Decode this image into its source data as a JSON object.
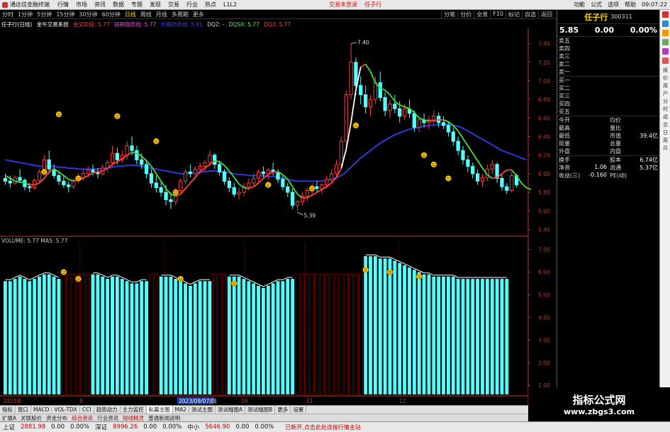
{
  "menubar": {
    "app_title": "通达信金融终端",
    "items": [
      "行情",
      "市场",
      "资讯",
      "数据",
      "专题",
      "发现",
      "交易",
      "行业",
      "热点",
      "L1L2"
    ],
    "active_index": -1,
    "promo": [
      "交易未登录",
      "任子行"
    ],
    "right": [
      "功能",
      "公式",
      "选项",
      "帮助",
      "09:07:22"
    ]
  },
  "toolbar": {
    "periods": [
      "分时",
      "1分钟",
      "5分钟",
      "15分钟",
      "30分钟",
      "60分钟",
      "日线",
      "周线",
      "月线",
      "多周期",
      "更多"
    ],
    "right": [
      "分笔",
      "分价",
      "全景",
      "F10",
      "标记",
      "自选",
      "返回"
    ]
  },
  "legend": {
    "title": "任子行(日线)",
    "system": "金牛交易系统",
    "items": [
      {
        "label": "金叉阶段: 5.77",
        "color": "#ff3b3b"
      },
      {
        "label": "短期趋势线: 5.77",
        "color": "#ff40ff"
      },
      {
        "label": "长期趋势线: 5.91",
        "color": "#3a3aff"
      },
      {
        "label": "DQ2: -",
        "color": "#dddddd"
      },
      {
        "label": "DQSX: 5.77",
        "color": "#44ff44"
      },
      {
        "label": "DQ3: 5.77",
        "color": "#ff4040"
      }
    ]
  },
  "volume_legend": {
    "label": "VOLUME: 5.77  MA5: 5.77"
  },
  "chart_data": {
    "type": "candlestick",
    "price_axis": [
      7.4,
      7.2,
      7.0,
      6.8,
      6.6,
      6.4,
      6.2,
      6.0,
      5.8,
      5.6,
      5.4
    ],
    "volume_axis": [
      7.0,
      6.0,
      5.0,
      4.0,
      3.0,
      2.0,
      1.0
    ],
    "date_labels": [
      "2023年",
      "8",
      "2023/09/07/四",
      "10",
      "11",
      "12"
    ],
    "annotations": {
      "high": "7.40",
      "low": "5.39"
    },
    "candles": [
      [
        5.95,
        6.0,
        5.88,
        5.92
      ],
      [
        5.92,
        5.98,
        5.85,
        5.9
      ],
      [
        5.9,
        5.98,
        5.88,
        5.96
      ],
      [
        5.96,
        6.05,
        5.9,
        5.93
      ],
      [
        5.93,
        5.95,
        5.82,
        5.86
      ],
      [
        5.86,
        5.9,
        5.8,
        5.85
      ],
      [
        5.85,
        5.95,
        5.83,
        5.93
      ],
      [
        5.93,
        6.05,
        5.9,
        6.02
      ],
      [
        6.02,
        6.2,
        5.98,
        6.15
      ],
      [
        6.15,
        6.25,
        6.0,
        6.05
      ],
      [
        6.05,
        6.1,
        5.95,
        5.98
      ],
      [
        5.98,
        6.02,
        5.88,
        5.92
      ],
      [
        5.92,
        5.98,
        5.85,
        5.88
      ],
      [
        5.88,
        5.92,
        5.8,
        5.86
      ],
      [
        5.86,
        5.95,
        5.84,
        5.93
      ],
      [
        5.93,
        6.0,
        5.9,
        5.96
      ],
      [
        5.96,
        6.05,
        5.93,
        6.0
      ],
      [
        6.0,
        6.08,
        5.96,
        6.04
      ],
      [
        6.04,
        6.1,
        5.98,
        6.02
      ],
      [
        6.02,
        6.06,
        5.95,
        6.0
      ],
      [
        6.0,
        6.1,
        5.98,
        6.06
      ],
      [
        6.06,
        6.15,
        6.02,
        6.12
      ],
      [
        6.12,
        6.3,
        6.08,
        6.22
      ],
      [
        6.22,
        6.28,
        6.1,
        6.15
      ],
      [
        6.15,
        6.25,
        6.12,
        6.2
      ],
      [
        6.2,
        6.35,
        6.15,
        6.3
      ],
      [
        6.3,
        6.4,
        6.2,
        6.25
      ],
      [
        6.25,
        6.3,
        6.1,
        6.15
      ],
      [
        6.15,
        6.22,
        6.05,
        6.1
      ],
      [
        6.1,
        6.15,
        5.95,
        6.0
      ],
      [
        6.0,
        6.05,
        5.85,
        5.9
      ],
      [
        5.9,
        5.98,
        5.8,
        5.85
      ],
      [
        5.85,
        5.92,
        5.75,
        5.8
      ],
      [
        5.8,
        5.88,
        5.66,
        5.72
      ],
      [
        5.72,
        5.8,
        5.62,
        5.7
      ],
      [
        5.7,
        5.85,
        5.66,
        5.82
      ],
      [
        5.82,
        5.95,
        5.78,
        5.92
      ],
      [
        5.92,
        6.05,
        5.88,
        6.02
      ],
      [
        6.02,
        6.1,
        5.96,
        6.0
      ],
      [
        6.0,
        6.08,
        5.94,
        6.05
      ],
      [
        6.05,
        6.12,
        6.0,
        6.08
      ],
      [
        6.08,
        6.15,
        6.02,
        6.12
      ],
      [
        6.12,
        6.25,
        6.08,
        6.2
      ],
      [
        6.2,
        6.22,
        6.05,
        6.1
      ],
      [
        6.1,
        6.14,
        5.98,
        6.02
      ],
      [
        6.02,
        6.05,
        5.88,
        5.92
      ],
      [
        5.92,
        5.96,
        5.8,
        5.85
      ],
      [
        5.85,
        5.9,
        5.75,
        5.78
      ],
      [
        5.78,
        5.85,
        5.72,
        5.8
      ],
      [
        5.8,
        5.9,
        5.76,
        5.86
      ],
      [
        5.86,
        5.95,
        5.82,
        5.9
      ],
      [
        5.9,
        6.0,
        5.86,
        5.95
      ],
      [
        5.95,
        6.05,
        5.9,
        6.02
      ],
      [
        6.02,
        6.08,
        5.96,
        6.0
      ],
      [
        6.0,
        6.06,
        5.94,
        6.04
      ],
      [
        6.04,
        6.12,
        5.98,
        6.02
      ],
      [
        6.02,
        6.05,
        5.9,
        5.94
      ],
      [
        5.94,
        5.98,
        5.82,
        5.86
      ],
      [
        5.86,
        5.9,
        5.75,
        5.8
      ],
      [
        5.8,
        5.84,
        5.62,
        5.66
      ],
      [
        5.66,
        5.72,
        5.6,
        5.7
      ],
      [
        5.7,
        5.8,
        5.66,
        5.76
      ],
      [
        5.76,
        5.85,
        5.7,
        5.82
      ],
      [
        5.82,
        5.9,
        5.78,
        5.86
      ],
      [
        5.86,
        5.92,
        5.8,
        5.84
      ],
      [
        5.84,
        5.9,
        5.78,
        5.88
      ],
      [
        5.88,
        5.98,
        5.84,
        5.94
      ],
      [
        5.94,
        6.05,
        5.9,
        6.0
      ],
      [
        6.0,
        6.15,
        5.96,
        6.1
      ],
      [
        6.1,
        6.4,
        6.05,
        6.35
      ],
      [
        6.35,
        6.9,
        6.3,
        6.85
      ],
      [
        6.85,
        7.4,
        6.8,
        7.2
      ],
      [
        7.2,
        7.25,
        6.85,
        6.95
      ],
      [
        6.95,
        7.05,
        6.75,
        6.85
      ],
      [
        6.85,
        6.95,
        6.65,
        6.72
      ],
      [
        6.72,
        6.85,
        6.62,
        6.8
      ],
      [
        6.8,
        7.05,
        6.75,
        6.98
      ],
      [
        6.98,
        7.1,
        6.78,
        6.82
      ],
      [
        6.82,
        6.88,
        6.62,
        6.68
      ],
      [
        6.68,
        6.8,
        6.6,
        6.75
      ],
      [
        6.75,
        6.85,
        6.65,
        6.7
      ],
      [
        6.7,
        6.78,
        6.55,
        6.62
      ],
      [
        6.62,
        6.75,
        6.58,
        6.7
      ],
      [
        6.7,
        6.8,
        6.6,
        6.65
      ],
      [
        6.65,
        6.68,
        6.45,
        6.5
      ],
      [
        6.5,
        6.6,
        6.45,
        6.58
      ],
      [
        6.58,
        6.65,
        6.5,
        6.55
      ],
      [
        6.55,
        6.62,
        6.48,
        6.58
      ],
      [
        6.58,
        6.68,
        6.52,
        6.62
      ],
      [
        6.62,
        6.66,
        6.5,
        6.55
      ],
      [
        6.55,
        6.62,
        6.48,
        6.52
      ],
      [
        6.52,
        6.56,
        6.4,
        6.45
      ],
      [
        6.45,
        6.5,
        6.3,
        6.35
      ],
      [
        6.35,
        6.4,
        6.2,
        6.25
      ],
      [
        6.25,
        6.3,
        6.1,
        6.15
      ],
      [
        6.15,
        6.2,
        6.02,
        6.08
      ],
      [
        6.08,
        6.12,
        5.95,
        6.0
      ],
      [
        6.0,
        6.05,
        5.88,
        5.92
      ],
      [
        5.92,
        6.0,
        5.86,
        5.96
      ],
      [
        5.96,
        6.1,
        5.92,
        6.05
      ],
      [
        6.05,
        6.15,
        6.0,
        6.1
      ],
      [
        6.1,
        6.12,
        5.9,
        5.95
      ],
      [
        5.95,
        6.0,
        5.82,
        5.86
      ],
      [
        5.86,
        5.9,
        5.78,
        5.82
      ],
      [
        5.82,
        6.02,
        5.8,
        5.98
      ],
      [
        5.98,
        6.0,
        5.85,
        5.88
      ]
    ],
    "long_line": [
      6.15,
      6.14,
      6.13,
      6.12,
      6.11,
      6.1,
      6.09,
      6.08,
      6.08,
      6.08,
      6.08,
      6.07,
      6.07,
      6.06,
      6.06,
      6.05,
      6.05,
      6.05,
      6.05,
      6.05,
      6.06,
      6.06,
      6.07,
      6.08,
      6.08,
      6.09,
      6.09,
      6.09,
      6.08,
      6.07,
      6.06,
      6.05,
      6.04,
      6.03,
      6.02,
      6.01,
      6.0,
      6.0,
      6.01,
      6.01,
      6.02,
      6.02,
      6.03,
      6.03,
      6.02,
      6.02,
      6.01,
      6.0,
      5.99,
      5.99,
      5.98,
      5.98,
      5.98,
      5.98,
      5.97,
      5.97,
      5.96,
      5.95,
      5.94,
      5.93,
      5.92,
      5.92,
      5.92,
      5.92,
      5.92,
      5.92,
      5.93,
      5.94,
      5.96,
      5.98,
      6.02,
      6.07,
      6.12,
      6.17,
      6.21,
      6.25,
      6.29,
      6.33,
      6.36,
      6.39,
      6.42,
      6.44,
      6.46,
      6.48,
      6.49,
      6.5,
      6.51,
      6.52,
      6.52,
      6.53,
      6.53,
      6.53,
      6.52,
      6.51,
      6.49,
      6.46,
      6.43,
      6.4,
      6.37,
      6.34,
      6.31,
      6.28,
      6.25,
      6.23,
      6.21,
      6.19,
      6.17,
      6.15
    ],
    "short_line": [
      5.98,
      5.95,
      5.92,
      5.91,
      5.9,
      5.88,
      5.88,
      5.9,
      5.95,
      6.02,
      6.05,
      6.02,
      5.98,
      5.94,
      5.92,
      5.93,
      5.95,
      5.98,
      6.01,
      6.02,
      6.03,
      6.06,
      6.1,
      6.13,
      6.16,
      6.2,
      6.23,
      6.22,
      6.19,
      6.14,
      6.08,
      6.0,
      5.92,
      5.84,
      5.78,
      5.76,
      5.78,
      5.84,
      5.9,
      5.96,
      6.02,
      6.06,
      6.1,
      6.14,
      6.13,
      6.09,
      6.03,
      5.96,
      5.89,
      5.85,
      5.84,
      5.86,
      5.9,
      5.95,
      5.99,
      6.02,
      6.02,
      5.99,
      5.94,
      5.86,
      5.78,
      5.74,
      5.74,
      5.77,
      5.8,
      5.83,
      5.86,
      5.9,
      5.96,
      6.06,
      6.26,
      6.55,
      6.9,
      7.15,
      7.18,
      7.1,
      6.98,
      6.92,
      6.9,
      6.85,
      6.78,
      6.74,
      6.72,
      6.7,
      6.66,
      6.6,
      6.58,
      6.57,
      6.57,
      6.58,
      6.58,
      6.56,
      6.52,
      6.46,
      6.38,
      6.3,
      6.22,
      6.14,
      6.06,
      5.99,
      5.95,
      5.96,
      6.0,
      6.04,
      6.04,
      5.98,
      5.9,
      5.85,
      5.83
    ],
    "volumes": [
      5.6,
      5.6,
      5.7,
      5.8,
      5.7,
      5.6,
      5.7,
      5.8,
      5.9,
      5.9,
      5.8,
      5.7,
      0,
      0,
      0,
      0,
      0,
      0,
      5.9,
      5.9,
      5.8,
      5.7,
      5.8,
      5.8,
      5.7,
      5.6,
      5.5,
      5.5,
      5.6,
      5.6,
      0,
      0,
      5.8,
      5.8,
      5.8,
      5.7,
      5.6,
      5.5,
      5.4,
      5.5,
      5.6,
      5.6,
      5.6,
      0,
      0,
      0,
      5.8,
      5.8,
      5.8,
      5.7,
      5.6,
      5.5,
      5.4,
      5.3,
      5.4,
      5.5,
      5.6,
      5.6,
      5.7,
      5.7,
      0,
      0,
      0,
      0,
      0,
      0,
      0,
      0,
      0,
      0,
      0,
      0,
      0,
      0,
      6.7,
      6.7,
      6.7,
      6.6,
      6.6,
      6.6,
      6.5,
      6.4,
      6.3,
      6.2,
      6.1,
      6.0,
      5.9,
      5.9,
      5.8,
      5.8,
      5.8,
      5.8,
      5.8,
      5.7,
      5.7,
      5.7,
      5.7,
      5.7,
      5.7,
      5.7,
      5.7,
      5.7,
      5.7,
      5.7
    ],
    "smileys_price": [
      [
        11,
        6.64
      ],
      [
        23,
        6.62
      ],
      [
        31,
        6.35
      ],
      [
        8,
        6.02
      ],
      [
        15,
        5.95
      ],
      [
        35,
        5.8
      ],
      [
        54,
        5.88
      ],
      [
        63,
        5.84
      ],
      [
        63,
        5.84
      ],
      [
        72,
        6.52
      ],
      [
        86,
        6.2
      ],
      [
        88,
        6.1
      ],
      [
        91,
        5.95
      ]
    ],
    "smileys_volume": [
      [
        12,
        6.0
      ],
      [
        15,
        5.7
      ],
      [
        36,
        5.7
      ],
      [
        47,
        5.5
      ],
      [
        74,
        6.1
      ],
      [
        79,
        6.0
      ],
      [
        85,
        5.8
      ]
    ]
  },
  "quote": {
    "name": "任子行",
    "code": "300311",
    "price": "5.85",
    "change": "0.00",
    "pct": "0.00%",
    "asks": [
      "卖五",
      "卖四",
      "卖三",
      "卖二",
      "卖一"
    ],
    "bids": [
      "买一",
      "买二",
      "买三",
      "买四",
      "买五"
    ],
    "stats": [
      [
        "今开",
        "",
        "均价",
        ""
      ],
      [
        "最高",
        "",
        "量比",
        ""
      ],
      [
        "最低",
        "",
        "市值",
        "39.4亿"
      ],
      [
        "现量",
        "",
        "总量",
        ""
      ],
      [
        "外盘",
        "",
        "内盘",
        ""
      ],
      [
        "换手",
        "",
        "股本",
        "6.74亿"
      ],
      [
        "净资",
        "1.06",
        "流通",
        "5.37亿"
      ],
      [
        "收益(三)",
        "-0.160",
        "PE(动)",
        ""
      ]
    ]
  },
  "vtabs": [
    "报",
    "价",
    "用",
    "户",
    "分",
    "时",
    "成",
    "交",
    "日",
    "周",
    "月"
  ],
  "tabs": [
    "指标",
    "窗口",
    "MACD",
    "VOL-TDX",
    "CCI",
    "趋势动力",
    "主力监控",
    "私募主图",
    "MA2",
    "测试主图",
    "测试幅图A",
    "测试幅图B",
    "更多",
    "设置"
  ],
  "toolbar2": [
    "扩展A",
    "关联股价",
    "资金分布",
    "综合资讯",
    "行业资讯",
    "短线精灵",
    "普通新闻说明"
  ],
  "status": {
    "indices": [
      {
        "name": "上证",
        "value": "2881.98",
        "chg": "0.00",
        "pct": "0.00%"
      },
      {
        "name": "深证",
        "value": "8996.26",
        "chg": "0.00",
        "pct": "0.00%"
      },
      {
        "name": "中小",
        "value": "5646.90",
        "chg": "0.00",
        "pct": "0.00%"
      }
    ],
    "notice": "已断开,点击此处连接行情主站"
  },
  "watermark": {
    "line1": "指标公式网",
    "line2": "www.zbgs3.com"
  },
  "colors": {
    "up": "#ff3b3b",
    "down": "#54ffff",
    "long_line": "#2d3ad8",
    "short_up": "#ff4040",
    "short_down": "#40e040",
    "grid": "#7a0000",
    "volume": "#54ffff"
  }
}
